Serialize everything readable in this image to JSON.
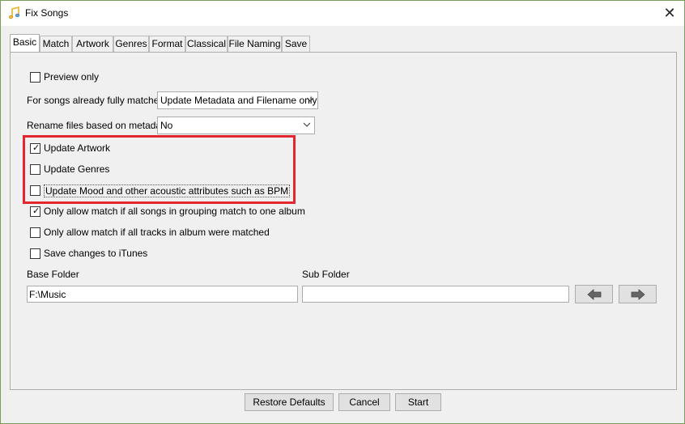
{
  "window": {
    "title": "Fix Songs",
    "close_glyph": "✕"
  },
  "tabs": [
    {
      "label": "Basic",
      "active": true
    },
    {
      "label": "Match"
    },
    {
      "label": "Artwork"
    },
    {
      "label": "Genres"
    },
    {
      "label": "Format"
    },
    {
      "label": "Classical"
    },
    {
      "label": "File Naming"
    },
    {
      "label": "Save"
    }
  ],
  "options": {
    "preview_only": {
      "label": "Preview only",
      "checked": false
    },
    "already_matched_label": "For songs already fully matched",
    "already_matched_value": "Update Metadata and Filename only",
    "rename_label": "Rename files based on metadata",
    "rename_value": "No",
    "update_artwork": {
      "label": "Update Artwork",
      "checked": true
    },
    "update_genres": {
      "label": "Update Genres",
      "checked": false
    },
    "update_mood": {
      "label": "Update Mood and other acoustic attributes such as BPM",
      "checked": false
    },
    "only_grouping": {
      "label": "Only allow match if all songs in grouping match to one album",
      "checked": true
    },
    "only_all_tracks": {
      "label": "Only allow match if all tracks in album were matched",
      "checked": false
    },
    "save_itunes": {
      "label": "Save changes to iTunes",
      "checked": false
    }
  },
  "folders": {
    "base_label": "Base Folder",
    "base_value": "F:\\Music",
    "sub_label": "Sub Folder",
    "sub_value": ""
  },
  "buttons": {
    "restore": "Restore Defaults",
    "cancel": "Cancel",
    "start": "Start"
  },
  "icons": {
    "app": "music-note-icon",
    "back": "arrow-left-icon",
    "forward": "arrow-right-icon"
  },
  "colors": {
    "highlight": "#e3262f",
    "window_border": "#7a9e58"
  }
}
